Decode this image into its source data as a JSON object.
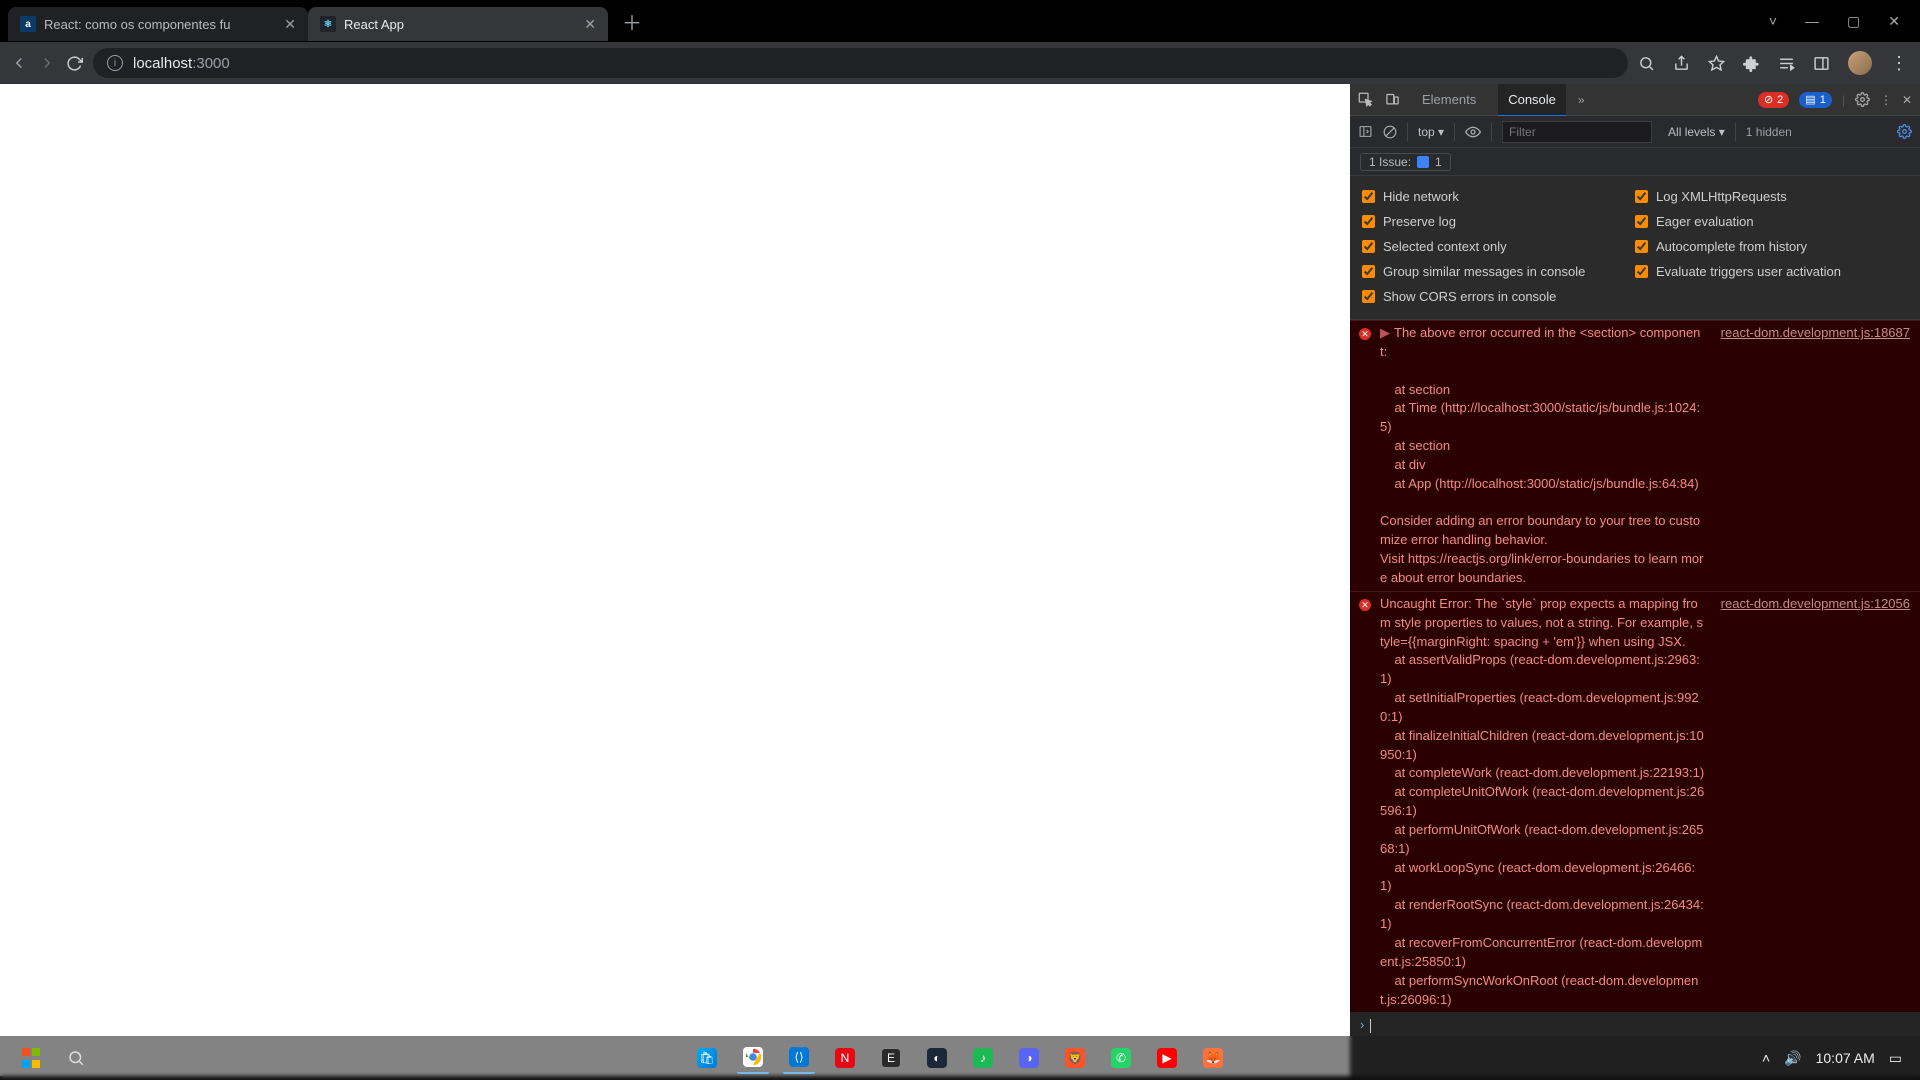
{
  "tabs": [
    {
      "title": "React: como os componentes fu",
      "favicon": {
        "bg": "#0a3b66",
        "text": "a"
      },
      "active": false
    },
    {
      "title": "React App",
      "favicon": {
        "bg": "#20232a",
        "text": "⚛"
      },
      "active": true
    }
  ],
  "url": {
    "host": "localhost",
    "port": ":3000"
  },
  "devtools": {
    "panels": {
      "elements": "Elements",
      "console": "Console"
    },
    "badges": {
      "errors": "2",
      "messages": "1"
    },
    "toolbar": {
      "context": "top",
      "filter_placeholder": "Filter",
      "levels": "All levels",
      "hidden": "1 hidden"
    },
    "issuebar": {
      "label": "1 Issue:",
      "count": "1"
    },
    "settings": [
      {
        "left": "Hide network",
        "right": "Log XMLHttpRequests"
      },
      {
        "left": "Preserve log",
        "right": "Eager evaluation"
      },
      {
        "left": "Selected context only",
        "right": "Autocomplete from history"
      },
      {
        "left": "Group similar messages in console",
        "right": "Evaluate triggers user activation"
      },
      {
        "left": "Show CORS errors in console",
        "right": ""
      }
    ],
    "errors": [
      {
        "source": "react-dom.development.js:18687",
        "body": "The above error occurred in the <section> component:\n\n    at section\n    at Time (http://localhost:3000/static/js/bundle.js:1024:5)\n    at section\n    at div\n    at App (http://localhost:3000/static/js/bundle.js:64:84)\n\nConsider adding an error boundary to your tree to customize error handling behavior.\nVisit https://reactjs.org/link/error-boundaries to learn more about error boundaries."
      },
      {
        "source": "react-dom.development.js:12056",
        "body": "Uncaught Error: The `style` prop expects a mapping from style properties to values, not a string. For example, style={{marginRight: spacing + 'em'}} when using JSX.\n    at assertValidProps (react-dom.development.js:2963:1)\n    at setInitialProperties (react-dom.development.js:9920:1)\n    at finalizeInitialChildren (react-dom.development.js:10950:1)\n    at completeWork (react-dom.development.js:22193:1)\n    at completeUnitOfWork (react-dom.development.js:26596:1)\n    at performUnitOfWork (react-dom.development.js:26568:1)\n    at workLoopSync (react-dom.development.js:26466:1)\n    at renderRootSync (react-dom.development.js:26434:1)\n    at recoverFromConcurrentError (react-dom.development.js:25850:1)\n    at performSyncWorkOnRoot (react-dom.development.js:26096:1)"
      }
    ]
  },
  "taskbar": {
    "time": "10:07 AM"
  }
}
